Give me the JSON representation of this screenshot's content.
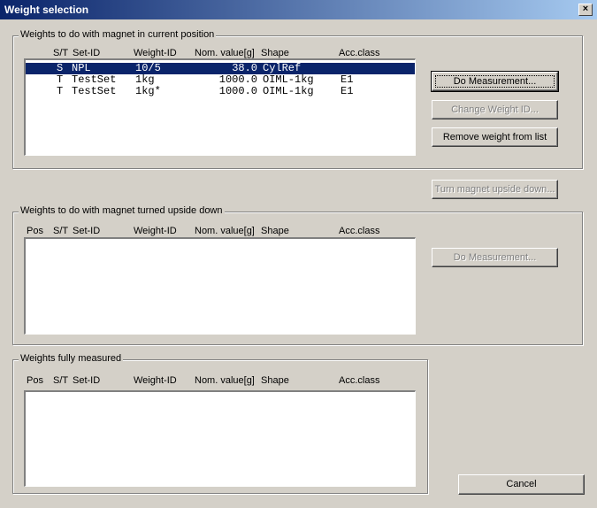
{
  "window": {
    "title": "Weight selection",
    "close_label": "×"
  },
  "group1": {
    "label": "Weights to do with magnet in current position",
    "headers": [
      "S/T",
      "Set-ID",
      "Weight-ID",
      "Nom. value[g]",
      "Shape",
      "Acc.class"
    ],
    "rows": [
      {
        "st": "S",
        "set": "NPL",
        "wid": "10/5",
        "nom": "38.0",
        "shape": "CylRef",
        "acc": "",
        "selected": true
      },
      {
        "st": "T",
        "set": "TestSet",
        "wid": "1kg",
        "nom": "1000.0",
        "shape": "OIML-1kg",
        "acc": "E1",
        "selected": false
      },
      {
        "st": "T",
        "set": "TestSet",
        "wid": "1kg*",
        "nom": "1000.0",
        "shape": "OIML-1kg",
        "acc": "E1",
        "selected": false
      }
    ],
    "buttons": {
      "do_measurement": "Do Measurement...",
      "change_weight_id": "Change Weight ID...",
      "remove_weight": "Remove weight from list"
    }
  },
  "turn_button": "Turn magnet upside down...",
  "group2": {
    "label": "Weights to do with magnet turned upside down",
    "headers": [
      "Pos",
      "S/T",
      "Set-ID",
      "Weight-ID",
      "Nom. value[g]",
      "Shape",
      "Acc.class"
    ],
    "buttons": {
      "do_measurement": "Do Measurement..."
    }
  },
  "group3": {
    "label": "Weights fully measured",
    "headers": [
      "Pos",
      "S/T",
      "Set-ID",
      "Weight-ID",
      "Nom. value[g]",
      "Shape",
      "Acc.class"
    ]
  },
  "cancel_button": "Cancel"
}
